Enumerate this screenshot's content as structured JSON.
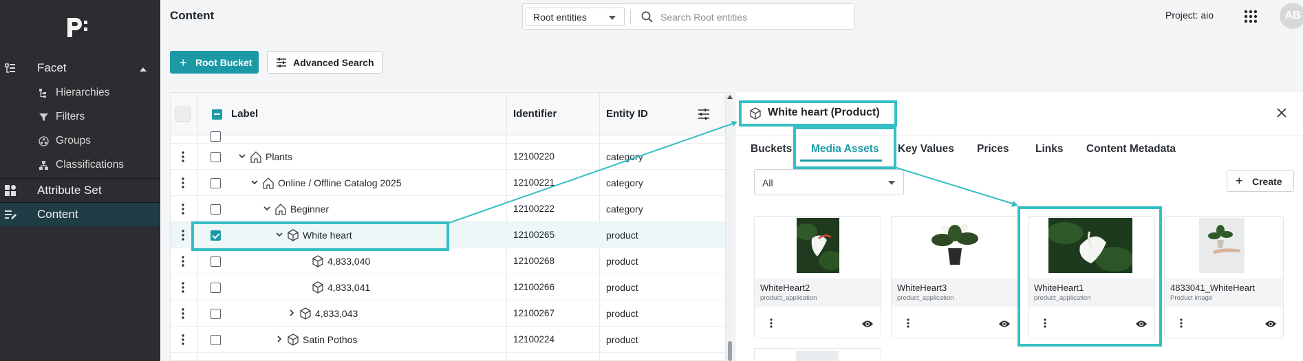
{
  "sidebar": {
    "items": [
      {
        "label": "Facet",
        "icon": "facet-icon"
      },
      {
        "label": "Attribute Set",
        "icon": "attribute-set-icon"
      },
      {
        "label": "Content",
        "icon": "content-icon"
      }
    ],
    "sub_items": [
      {
        "label": "Hierarchies",
        "icon": "hierarchy-icon"
      },
      {
        "label": "Filters",
        "icon": "filter-icon"
      },
      {
        "label": "Groups",
        "icon": "groups-icon"
      },
      {
        "label": "Classifications",
        "icon": "classification-icon"
      }
    ]
  },
  "header": {
    "title": "Content",
    "entity_select": "Root entities",
    "search_placeholder": "Search Root entities",
    "project": "Project: aio",
    "avatar": "AB"
  },
  "toolbar": {
    "root_bucket_label": "Root Bucket",
    "advanced_search_label": "Advanced Search"
  },
  "table": {
    "columns": [
      "Label",
      "Identifier",
      "Entity ID"
    ],
    "rows": [
      {
        "label": "Plants",
        "identifier": "12100220",
        "entity_id": "category",
        "expanded": true
      },
      {
        "label": "Online / Offline Catalog 2025",
        "identifier": "12100221",
        "entity_id": "category",
        "expanded": true
      },
      {
        "label": "Beginner",
        "identifier": "12100222",
        "entity_id": "category",
        "expanded": true
      },
      {
        "label": "White heart",
        "identifier": "12100265",
        "entity_id": "product",
        "expanded": true,
        "selected": true
      },
      {
        "label": "4,833,040",
        "identifier": "12100268",
        "entity_id": "product"
      },
      {
        "label": "4,833,041",
        "identifier": "12100266",
        "entity_id": "product"
      },
      {
        "label": "4,833,043",
        "identifier": "12100267",
        "entity_id": "product",
        "expanded": false
      },
      {
        "label": "Satin Pothos",
        "identifier": "12100224",
        "entity_id": "product",
        "expanded": false
      }
    ]
  },
  "panel": {
    "title": "White heart (Product)",
    "tabs": [
      "Buckets",
      "Media Assets",
      "Key Values",
      "Prices",
      "Links",
      "Content Metadata"
    ],
    "active_tab": "Media Assets",
    "filter_value": "All",
    "create_label": "Create",
    "assets": [
      {
        "title": "WhiteHeart2",
        "type": "product_application"
      },
      {
        "title": "WhiteHeart3",
        "type": "product_application"
      },
      {
        "title": "WhiteHeart1",
        "type": "product_application"
      },
      {
        "title": "4833041_WhiteHeart",
        "type": "Product image"
      }
    ]
  },
  "colors": {
    "accent": "#1b9aa6",
    "highlight": "#35bfc4",
    "sidebar_bg": "#2b2d30",
    "sidebar_active": "#1f3d44"
  }
}
